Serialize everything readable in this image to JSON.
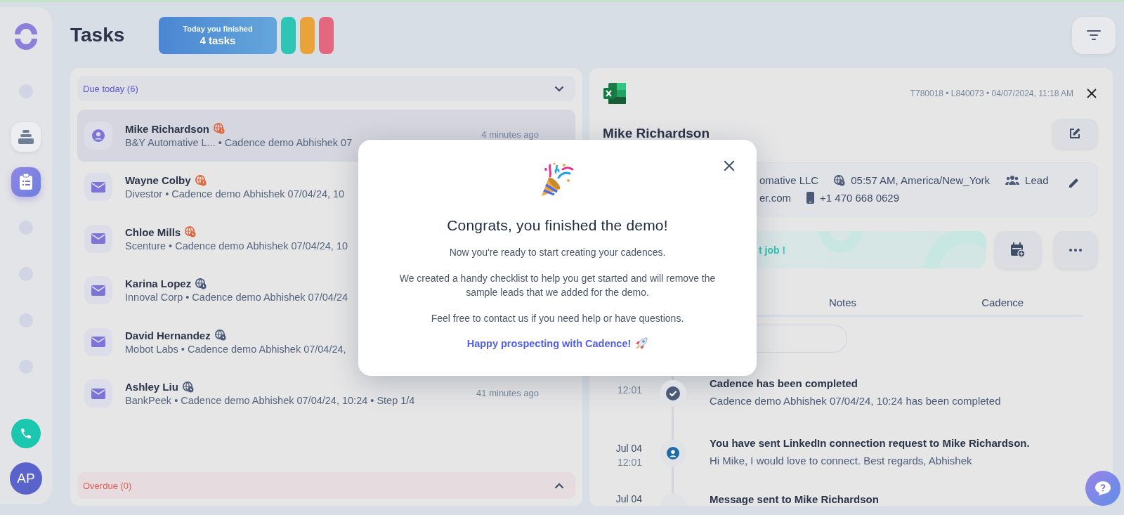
{
  "sidebar": {
    "items": [
      {
        "kind": "dot",
        "selected": false
      },
      {
        "kind": "stack",
        "selected": false
      },
      {
        "kind": "clipboard",
        "selected": true
      },
      {
        "kind": "dot",
        "selected": false
      },
      {
        "kind": "dot",
        "selected": false
      },
      {
        "kind": "dot",
        "selected": false
      },
      {
        "kind": "dot",
        "selected": false
      }
    ],
    "avatar": "AP"
  },
  "page_title": "Tasks",
  "summary": {
    "label": "Today you finished",
    "value": "4 tasks"
  },
  "pills": [
    {
      "color": "#2ec4b6"
    },
    {
      "color": "#eaa23a"
    },
    {
      "color": "#e2687f"
    }
  ],
  "task_groups": [
    {
      "kind": "due",
      "title": "Due today (6)",
      "expanded": true,
      "tasks": [
        {
          "kind": "contact",
          "name": "Mike Richardson",
          "color": "#e0663a",
          "subtitle": "B&Y Automative L... • Cadence demo Abhishek 07",
          "time": "4 minutes ago",
          "selected": true
        },
        {
          "kind": "email",
          "name": "Wayne Colby",
          "color": "#e0663a",
          "subtitle": "Divestor • Cadence demo Abhishek 07/04/24, 10",
          "selected": false
        },
        {
          "kind": "email",
          "name": "Chloe Mills",
          "color": "#e0663a",
          "subtitle": "Scenture • Cadence demo Abhishek 07/04/24, 10",
          "selected": false
        },
        {
          "kind": "email",
          "name": "Karina Lopez",
          "color": "#4a5a78",
          "subtitle": "Innoval Corp • Cadence demo Abhishek 07/04/24",
          "selected": false
        },
        {
          "kind": "email",
          "name": "David Hernandez",
          "color": "#4a5a78",
          "subtitle": "Mobot Labs • Cadence demo Abhishek 07/04/24,",
          "selected": false
        },
        {
          "kind": "email",
          "name": "Ashley Liu",
          "color": "#4a5a78",
          "subtitle": "BankPeek • Cadence demo Abhishek 07/04/24, 10:24 • Step 1/4",
          "time": "41 minutes ago",
          "selected": false
        }
      ]
    },
    {
      "kind": "overdue",
      "title": "Overdue (0)",
      "expanded": false
    }
  ],
  "lead": {
    "meta": "T780018 • L840073 • 04/07/2024, 11:18 AM",
    "name": "Mike Richardson",
    "info_rows": [
      [
        {
          "kind": "text",
          "text": "omative LLC"
        },
        {
          "kind": "timezone",
          "text": "05:57 AM, America/New_York"
        },
        {
          "kind": "type",
          "text": "Lead"
        }
      ],
      [
        {
          "kind": "text",
          "text": "er.com"
        },
        {
          "kind": "phone",
          "text": "+1 470 668 0629"
        }
      ]
    ],
    "banner": "t job !",
    "tabs": [
      {
        "label": "Notes",
        "selected": false
      },
      {
        "label": "Cadence",
        "selected": false
      }
    ],
    "activities": [
      {
        "kind": "completed",
        "time": "12:01",
        "title": "Cadence has been completed",
        "text": "Cadence demo Abhishek 07/04/24, 10:24 has been completed"
      },
      {
        "kind": "linkedin",
        "date": "Jul 04",
        "time": "12:01",
        "title": "You have sent LinkedIn connection request to Mike Richardson.",
        "text": "Hi Mike, I would love to connect. Best regards, Abhishek"
      },
      {
        "kind": "message",
        "date": "Jul 04",
        "title": "Message sent to Mike Richardson"
      }
    ]
  },
  "modal": {
    "title": "Congrats, you finished the demo!",
    "paragraphs": [
      "Now you're ready to start creating your cadences.",
      "We created a handy checklist to help you get started and will remove the sample leads that we added for the demo.",
      "Feel free to contact us if you need help or have questions."
    ],
    "link": "Happy prospecting with Cadence!"
  }
}
